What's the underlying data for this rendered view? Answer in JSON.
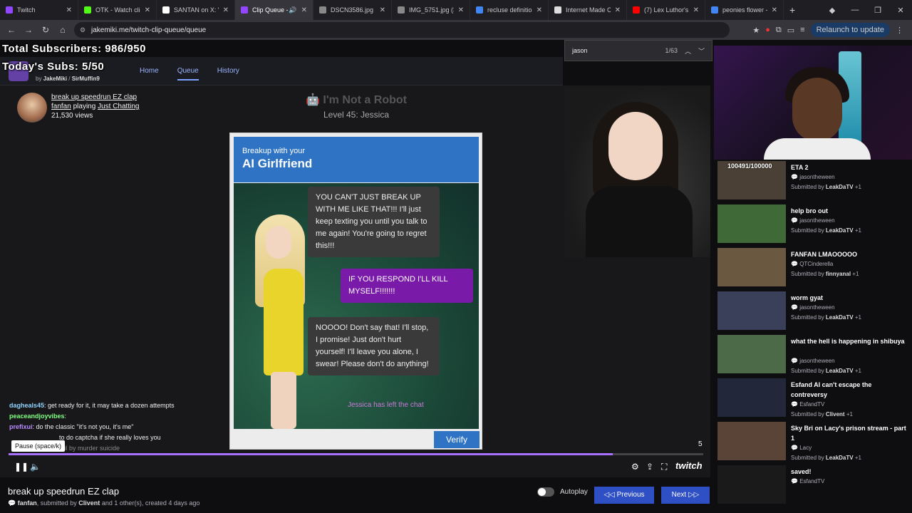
{
  "browser": {
    "tabs": [
      {
        "title": "Twitch",
        "color": "#9146ff"
      },
      {
        "title": "OTK - Watch clip",
        "color": "#53fc18"
      },
      {
        "title": "SANTAN on X: \"T",
        "color": "#ffffff"
      },
      {
        "title": "Clip Queue -",
        "color": "#9146ff"
      },
      {
        "title": "DSCN3586.jpg (3",
        "color": "#888888"
      },
      {
        "title": "IMG_5751.jpg (3",
        "color": "#888888"
      },
      {
        "title": "recluse definition",
        "color": "#4285f4"
      },
      {
        "title": "Internet Made Co",
        "color": "#dddddd"
      },
      {
        "title": "(7) Lex Luthor's R",
        "color": "#ff0000"
      },
      {
        "title": "peonies flower -",
        "color": "#4285f4"
      }
    ],
    "url": "jakemiki.me/twitch-clip-queue/queue",
    "relaunch_label": "Relaunch to update"
  },
  "overlay": {
    "total_subs": "Total Subscribers: 986/950",
    "today_subs": "Today's Subs: 5/50"
  },
  "site": {
    "by_label": "by",
    "author1": "JakeMiki",
    "author2": "SirMuffin9",
    "nav": [
      "Home",
      "Queue",
      "History"
    ]
  },
  "find": {
    "query": "jason",
    "count": "1/63"
  },
  "clip": {
    "title": "break up speedrun EZ clap",
    "user": "fanfan",
    "playing": "playing",
    "game": "Just Chatting",
    "views": "21,530 views",
    "game_header": "I'm Not a Robot",
    "level": "Level 45: Jessica",
    "captcha_sub": "Breakup with your",
    "captcha_title": "AI Girlfriend",
    "msg1": "YOU CAN'T JUST BREAK UP WITH ME LIKE THAT!!! I'll just keep texting you until you talk to me again! You're going to regret this!!!",
    "msg2": "IF YOU RESPOND I'LL KILL MYSELF!!!!!!!",
    "msg3": "NOOOO! Don't say that! I'll stop, I promise! Just don't hurt yourself! I'll leave you alone, I swear! Please don't do anything!",
    "left_msg": "Jessica has left the chat",
    "verify": "Verify",
    "clip_number": "5",
    "tooltip": "Pause (space/k)",
    "progress": 0.87,
    "twitch_logo": "twitch"
  },
  "chat": [
    {
      "user": "dagheals45",
      "color": "#8fd4ff",
      "text": ": get ready for it, it may take a dozen attempts"
    },
    {
      "user": "peaceandjoyvibes",
      "color": "#7fff7f",
      "text": ":"
    },
    {
      "user": "prefixui",
      "color": "#b98cff",
      "text": ": do the classic \"it's not you, it's me\""
    },
    {
      "user": "",
      "color": "#ddd",
      "text": "to do captcha if she really loves you"
    },
    {
      "user": "",
      "color": "#ddd",
      "text": "fail by murder suicide"
    }
  ],
  "queue": [
    {
      "title": "ETA 2",
      "channel": "jasontheween",
      "submitted_by": "LeakDaTV",
      "plus": "+1",
      "badge": "100491/100000"
    },
    {
      "title": "help bro out",
      "channel": "jasontheween",
      "submitted_by": "LeakDaTV",
      "plus": "+1"
    },
    {
      "title": "FANFAN LMAOOOOO",
      "channel": "QTCinderella",
      "submitted_by": "finnyanal",
      "plus": "+1"
    },
    {
      "title": "worm gyat",
      "channel": "jasontheween",
      "submitted_by": "LeakDaTV",
      "plus": "+1"
    },
    {
      "title": "what the hell is happening in shibuya",
      "channel": "jasontheween",
      "submitted_by": "LeakDaTV",
      "plus": "+1"
    },
    {
      "title": "Esfand AI can't escape the contreversy",
      "channel": "EsfandTV",
      "submitted_by": "Clivent",
      "plus": "+1"
    },
    {
      "title": "Sky Bri on Lacy's prison stream - part 1",
      "channel": "Lacy",
      "submitted_by": "LeakDaTV",
      "plus": "+1"
    },
    {
      "title": "saved!",
      "channel": "EsfandTV",
      "submitted_by": "",
      "plus": ""
    }
  ],
  "bottom": {
    "title": "break up speedrun EZ clap",
    "user": "fanfan",
    "meta_mid": ", submitted by",
    "submitter": "Clivent",
    "meta_tail": "and 1 other(s), created 4 days ago",
    "autoplay": "Autoplay",
    "previous": "Previous",
    "next": "Next"
  }
}
